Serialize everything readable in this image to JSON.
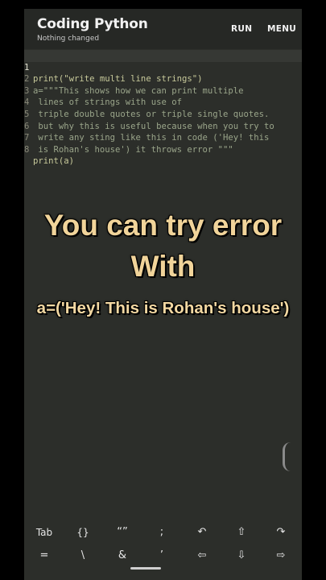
{
  "app": {
    "title": "Coding Python",
    "subtitle": "Nothing changed",
    "run_label": "RUN",
    "menu_label": "MENU"
  },
  "editor": {
    "lines": [
      {
        "num": "1",
        "text": "print(\"write multi line strings\")"
      },
      {
        "num": "2",
        "text": "a=\"\"\"This shows how we can print multiple"
      },
      {
        "num": "3",
        "text": " lines of strings with use of"
      },
      {
        "num": "4",
        "text": " triple double quotes or triple single quotes."
      },
      {
        "num": "5",
        "text": " but why this is useful because when you try to"
      },
      {
        "num": "6",
        "text": " write any sting like this in code ('Hey! this"
      },
      {
        "num": "7",
        "text": " is Rohan's house') it throws error \"\"\""
      },
      {
        "num": "8",
        "text": "print(a)"
      }
    ]
  },
  "overlay": {
    "line1": "You can try error",
    "line2": "With",
    "line3": "a=('Hey! This is Rohan's house')"
  },
  "keyboard": {
    "row1": [
      "Tab",
      "{}",
      "“”",
      ";",
      "↶",
      "⇧",
      "↷"
    ],
    "row2": [
      "=",
      "\\",
      "&",
      "’",
      "⇦",
      "⇩",
      "⇨"
    ],
    "icons": {
      "undo": "undo-icon",
      "shift": "shift-up-icon",
      "redo": "redo-icon",
      "left": "arrow-left-icon",
      "down": "arrow-down-icon",
      "right": "arrow-right-icon"
    }
  }
}
